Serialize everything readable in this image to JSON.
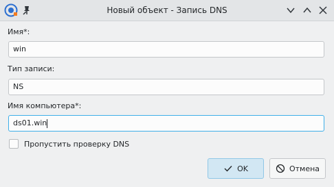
{
  "window": {
    "title": "Новый объект - Запись DNS",
    "app_icon": "dns-app-icon",
    "pin_icon": "pin-icon",
    "controls": [
      "minimize-icon",
      "maximize-icon",
      "close-icon"
    ]
  },
  "form": {
    "name_label": "Имя*:",
    "name_value": "win",
    "type_label": "Тип записи:",
    "type_value": "NS",
    "computer_label": "Имя компьютера*:",
    "computer_value": "ds01.win",
    "skip_check_label": "Пропустить проверку DNS",
    "skip_check_checked": false
  },
  "buttons": {
    "ok_label": "OK",
    "cancel_label": "Отмена"
  },
  "colors": {
    "accent": "#3daee9",
    "window_bg": "#eff0f1"
  }
}
